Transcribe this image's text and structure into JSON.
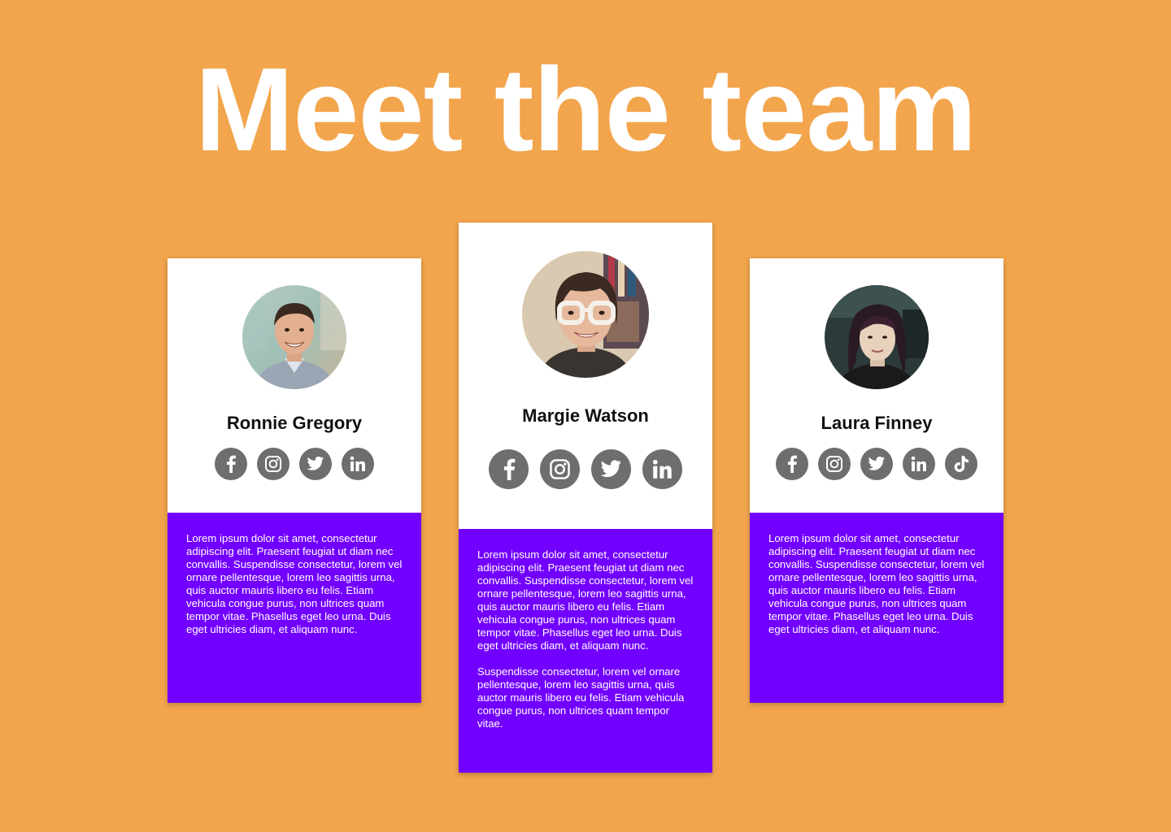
{
  "page": {
    "title": "Meet the team",
    "background_color": "#F2A54C",
    "accent_color": "#7200FF"
  },
  "members": [
    {
      "name": "Ronnie Gregory",
      "avatar": "portrait-photo-man-smiling",
      "socials": [
        "facebook-icon",
        "instagram-icon",
        "twitter-icon",
        "linkedin-icon"
      ],
      "bio": [
        "Lorem ipsum dolor sit amet, consectetur adipiscing elit. Praesent feugiat ut diam nec convallis. Suspendisse consectetur, lorem vel ornare pellentesque, lorem leo sagittis urna, quis auctor mauris libero eu felis. Etiam vehicula congue purus, non ultrices quam tempor vitae. Phasellus eget leo urna. Duis eget ultricies diam, et aliquam nunc."
      ]
    },
    {
      "name": "Margie Watson",
      "avatar": "portrait-photo-woman-glasses",
      "socials": [
        "facebook-icon",
        "instagram-icon",
        "twitter-icon",
        "linkedin-icon"
      ],
      "bio": [
        "Lorem ipsum dolor sit amet, consectetur adipiscing elit. Praesent feugiat ut diam nec convallis. Suspendisse consectetur, lorem vel ornare pellentesque, lorem leo sagittis urna, quis auctor mauris libero eu felis. Etiam vehicula congue purus, non ultrices quam tempor vitae. Phasellus eget leo urna. Duis eget ultricies diam, et aliquam nunc.",
        "Suspendisse consectetur, lorem vel ornare pellentesque, lorem leo sagittis urna, quis auctor mauris libero eu felis. Etiam vehicula congue purus, non ultrices quam tempor vitae."
      ]
    },
    {
      "name": "Laura Finney",
      "avatar": "portrait-photo-woman-car",
      "socials": [
        "facebook-icon",
        "instagram-icon",
        "twitter-icon",
        "linkedin-icon",
        "tiktok-icon"
      ],
      "bio": [
        "Lorem ipsum dolor sit amet, consectetur adipiscing elit. Praesent feugiat ut diam nec convallis. Suspendisse consectetur, lorem vel ornare pellentesque, lorem leo sagittis urna, quis auctor mauris libero eu felis. Etiam vehicula congue purus, non ultrices quam tempor vitae. Phasellus eget leo urna. Duis eget ultricies diam, et aliquam nunc."
      ]
    }
  ]
}
